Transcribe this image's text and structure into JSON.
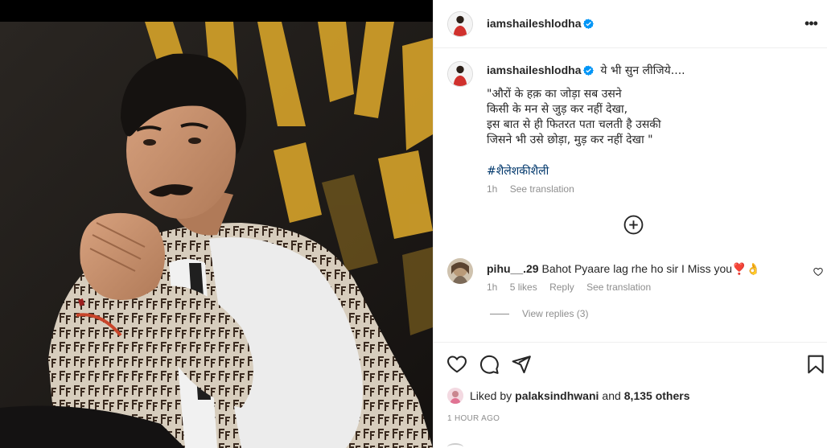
{
  "post": {
    "username": "iamshaileshlodha",
    "verified": true,
    "more_icon": "more-horizontal-icon",
    "more_label": "•••"
  },
  "caption": {
    "username": "iamshaileshlodha",
    "intro": "ये भी सुन लीजिये....",
    "quote": "\"औरों के हक़ का जोड़ा सब उसने\nकिसी के मन से जुड़ कर नहीं देखा,\nइस बात से ही फितरत पता चलती है उसकी\nजिसने भी उसे छोड़ा, मुड़ कर नहीं देखा \"",
    "hashtag": "#शैलेशकीशैली",
    "time": "1h",
    "see_translation": "See translation"
  },
  "load_more_icon": "plus-circle-icon",
  "comment": {
    "username": "pihu__.29",
    "text": "Bahot Pyaare lag rhe ho sir I Miss you❣️👌",
    "time": "1h",
    "likes": "5 likes",
    "reply": "Reply",
    "see_translation": "See translation",
    "view_replies": "View replies (3)"
  },
  "actions": {
    "icons": [
      "heart-icon",
      "comment-icon",
      "share-icon",
      "bookmark-icon"
    ]
  },
  "likes": {
    "prefix": "Liked by",
    "user": "palaksindhwani",
    "middle": "and",
    "others": "8,135 others"
  },
  "timestamp": "1 HOUR AGO",
  "colors": {
    "verified": "#0095f6",
    "link": "#00376b",
    "secondary": "#8e8e8e",
    "text": "#262626"
  }
}
